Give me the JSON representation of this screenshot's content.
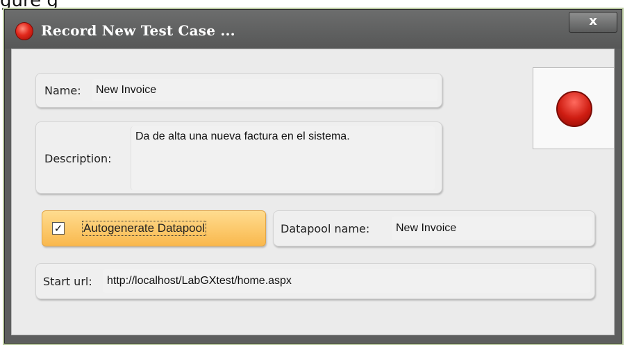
{
  "background_text": "gure g",
  "window": {
    "title": "Record New Test Case ...",
    "close_label": "x"
  },
  "form": {
    "name_label": "Name:",
    "name_value": "New Invoice",
    "description_label": "Description:",
    "description_value": "Da de alta una nueva factura en el sistema.",
    "autogenerate_label": "Autogenerate Datapool",
    "autogenerate_checked": true,
    "check_mark": "✓",
    "datapool_label": "Datapool name:",
    "datapool_value": "New Invoice",
    "start_url_label": "Start url:",
    "start_url_value": "http://localhost/LabGXtest/home.aspx"
  },
  "record_button": {
    "icon": "record-icon"
  },
  "colors": {
    "title_bar": "#5f6060",
    "client_bg": "#ebebeb",
    "autogenerate_highlight": "#fcc868",
    "record_red": "#cf1d12"
  }
}
